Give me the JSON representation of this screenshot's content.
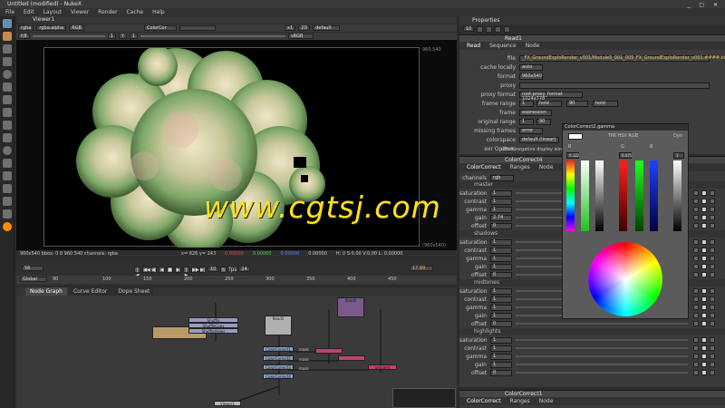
{
  "window": {
    "title": "Untitled (modified) - NukeX",
    "controls": "_ ▢ ✕"
  },
  "menu": [
    "File",
    "Edit",
    "Layout",
    "Viewer",
    "Render",
    "Cache",
    "Help"
  ],
  "viewer": {
    "tab": "Viewer1",
    "row1": {
      "channels": "rgba",
      "alpha": "rgba.alpha",
      "mode": "RGB",
      "input_a": "ColorCor",
      "input_b": "",
      "zoom": "x1",
      "view": "2D",
      "lut": "default"
    },
    "row2": {
      "fstop": "f/8",
      "frame": "1",
      "gain": "Y",
      "gamma": "1",
      "colorspace": "sRGB"
    },
    "format_label_tr": "960,540",
    "format_label_br": "(960x540)",
    "status": {
      "info": "960x540 bbox: 0 0 960 540 channels: rgba",
      "coords": "x= 626 y= 243",
      "r": "0.00000",
      "g": "0.00000",
      "b": "0.00000",
      "a": "0.00000",
      "hsv": "H: 0 S:0.00 V:0.00 L: 0.00000"
    }
  },
  "timeline": {
    "start": "56",
    "end": "17.89",
    "fps_label": "fps",
    "fps": "24",
    "increment": "10",
    "range_mode": "Global",
    "ticks": [
      "90",
      "100",
      "150",
      "200",
      "250",
      "300",
      "350",
      "400",
      "450"
    ]
  },
  "nodegraph": {
    "tabs": [
      "Node Graph",
      "Curve Editor",
      "Dope Sheet"
    ],
    "nodes": [
      "Shuffle",
      "ShuffleCopy",
      "ShuffleViews",
      "Read2",
      "Read1",
      "ColorCorrect1",
      "ColorCorrect2",
      "ColorCorrect3",
      "ColorCorrect4",
      "Viewer1"
    ],
    "labels": {
      "mask": "mask",
      "ambient": "ambient"
    }
  },
  "properties": {
    "title": "Properties",
    "count": "10",
    "read_node": {
      "name": "Read1",
      "tabs": [
        "Read",
        "Sequence",
        "Node"
      ],
      "file": "_FX_GroundExploRender_v001/Module5_001_005_FX_GroundExploRender_v001.####.exr",
      "cache_locally": "auto",
      "format": "960x540",
      "proxy": "",
      "proxy_format": "root.proxy_format 1024x778",
      "frame_range_start": "1",
      "frame_range_hold": "hold",
      "frame_range_end": "90",
      "frame_range_hold2": "hold",
      "frame": "expression",
      "original_range_start": "1",
      "original_range_end": "90",
      "missing_frames": "error",
      "colorspace": "default (linear)",
      "premultiplied": "premultiplied",
      "raw_data": "raw data",
      "exr_options": "exr Options",
      "offset_negative": "offset negative display window"
    },
    "cc_nodes": [
      {
        "name": "ColorCorrect4",
        "tabs": [
          "ColorCorrect",
          "Ranges",
          "Node"
        ],
        "channels": "rgb",
        "sections": [
          {
            "title": "master",
            "rows": [
              {
                "label": "saturation",
                "value": "1"
              },
              {
                "label": "contrast",
                "value": "1"
              },
              {
                "label": "gamma",
                "value": "1"
              },
              {
                "label": "gain",
                "value": "2.74"
              },
              {
                "label": "offset",
                "value": "0"
              }
            ]
          },
          {
            "title": "shadows",
            "rows": [
              {
                "label": "saturation",
                "value": "1"
              },
              {
                "label": "contrast",
                "value": "1"
              },
              {
                "label": "gamma",
                "value": "1"
              },
              {
                "label": "gain",
                "value": "1"
              },
              {
                "label": "offset",
                "value": "0"
              }
            ]
          },
          {
            "title": "midtones",
            "rows": [
              {
                "label": "saturation",
                "value": "1"
              },
              {
                "label": "contrast",
                "value": "1"
              },
              {
                "label": "gamma",
                "value": "1"
              },
              {
                "label": "gain",
                "value": "1"
              },
              {
                "label": "offset",
                "value": "0"
              }
            ]
          },
          {
            "title": "highlights",
            "rows": [
              {
                "label": "saturation",
                "value": "1"
              },
              {
                "label": "contrast",
                "value": "1"
              },
              {
                "label": "gamma",
                "value": "1"
              },
              {
                "label": "gain",
                "value": "1"
              },
              {
                "label": "offset",
                "value": "0"
              }
            ]
          }
        ]
      },
      {
        "name": "ColorCorrect1",
        "tabs": [
          "ColorCorrect",
          "Ranges",
          "Node"
        ]
      }
    ]
  },
  "color_picker": {
    "title": "ColorCorrect2.gamma",
    "modes": "TMI HSV RGB",
    "dyn": "Dyn",
    "channels": [
      "R",
      "G",
      "B"
    ],
    "values": [
      "0.122",
      "0.075",
      "1"
    ]
  },
  "watermark": "www.cgtsj.com",
  "colors": {
    "accent": "#ff8c00",
    "watermark": "#ffe11a"
  }
}
